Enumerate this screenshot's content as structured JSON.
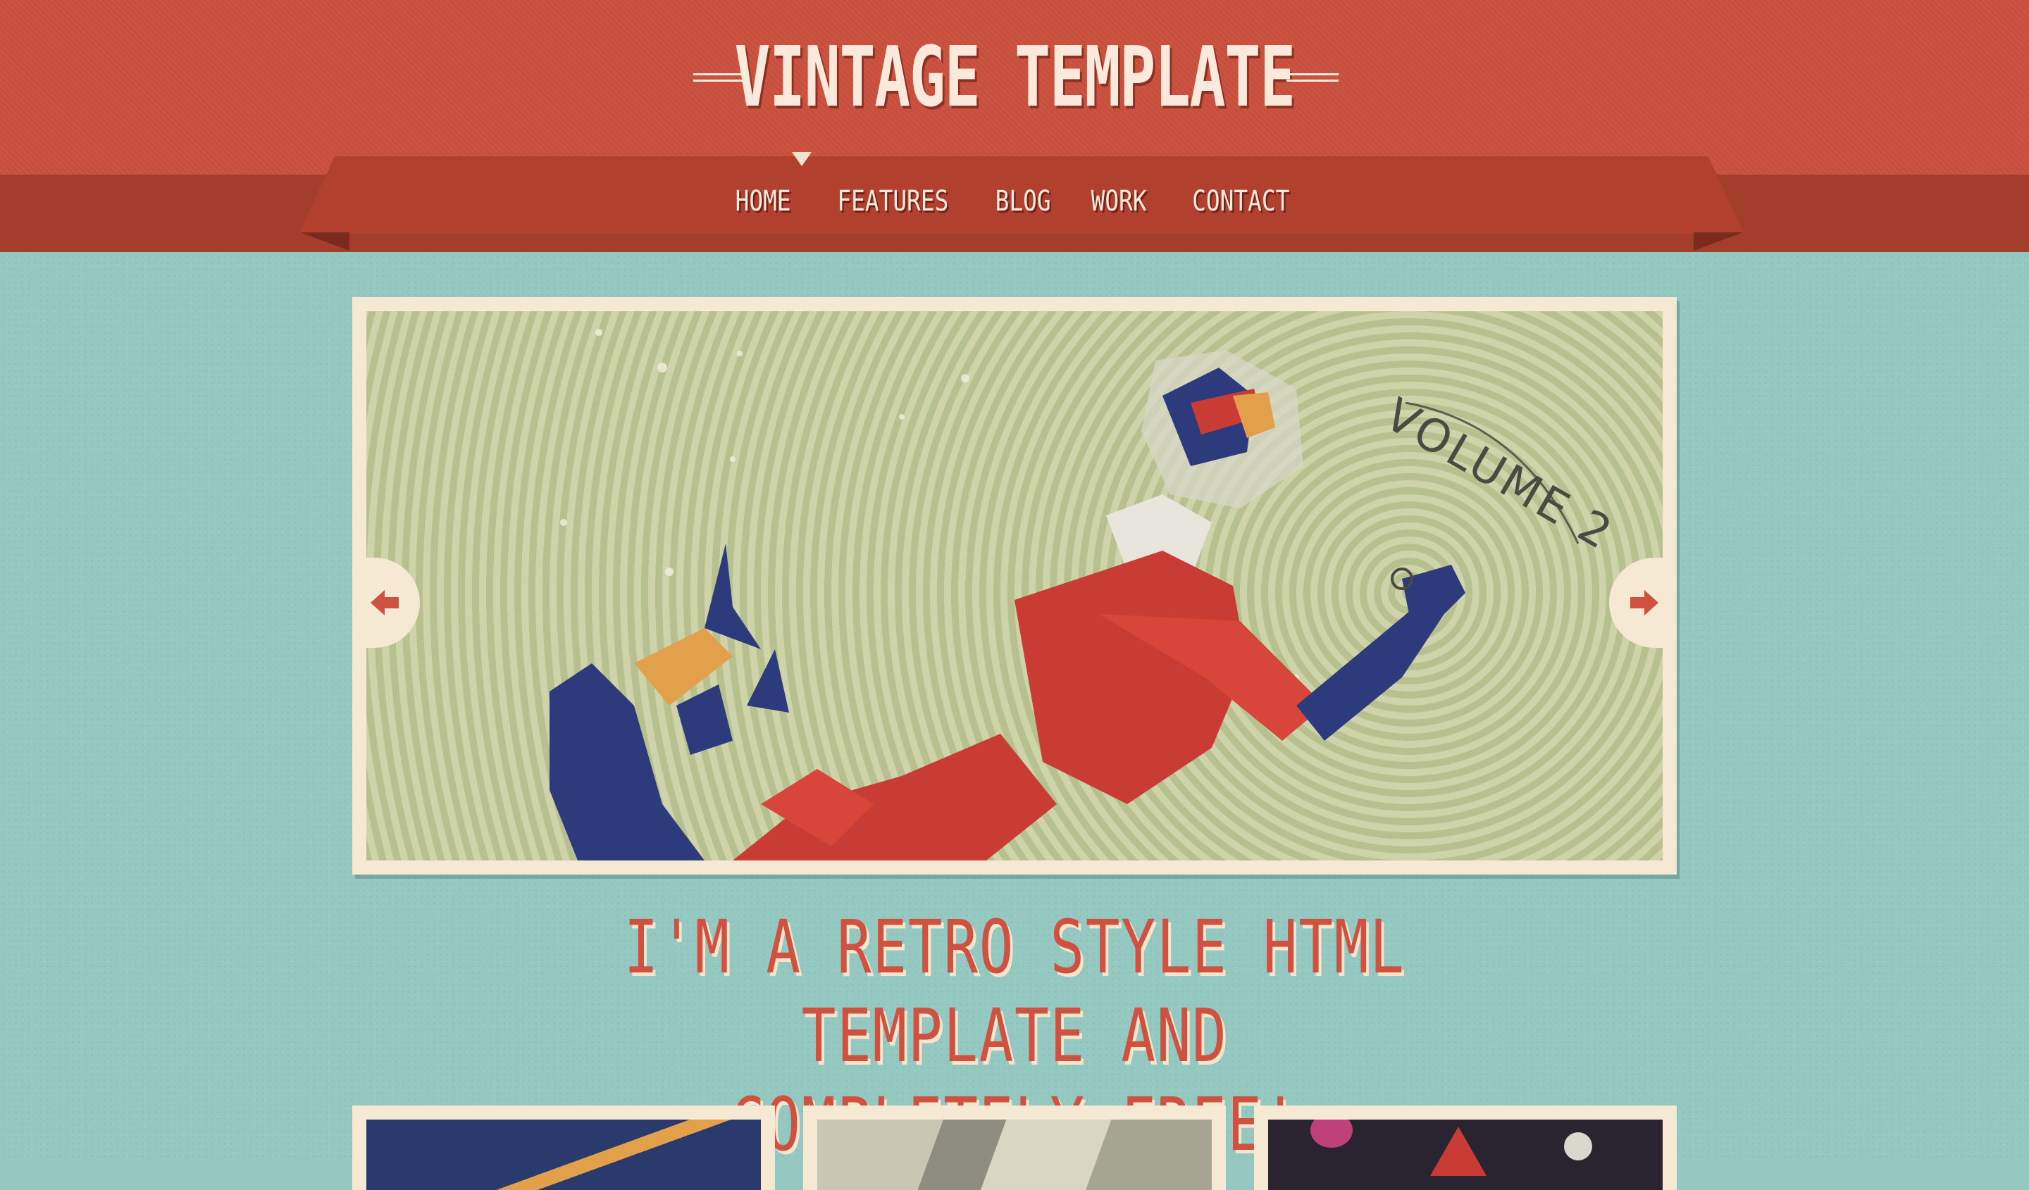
{
  "site": {
    "title": "VINTAGE TEMPLATE"
  },
  "nav": {
    "items": [
      {
        "label": "HOME"
      },
      {
        "label": "FEATURES"
      },
      {
        "label": "BLOG"
      },
      {
        "label": "WORK"
      },
      {
        "label": "CONTACT"
      }
    ],
    "active": "HOME"
  },
  "slider": {
    "slide_text": "VOLUME 2",
    "prev_icon": "arrow-left-icon",
    "next_icon": "arrow-right-icon"
  },
  "tagline": {
    "line1": "I'M A RETRO STYLE HTML TEMPLATE AND",
    "line2": "COMPLETELY FREE!"
  },
  "colors": {
    "header": "#c94f3d",
    "header_dark": "#a33d2c",
    "background": "#94c8c1",
    "frame": "#f5e9d3",
    "accent": "#cf5140"
  }
}
